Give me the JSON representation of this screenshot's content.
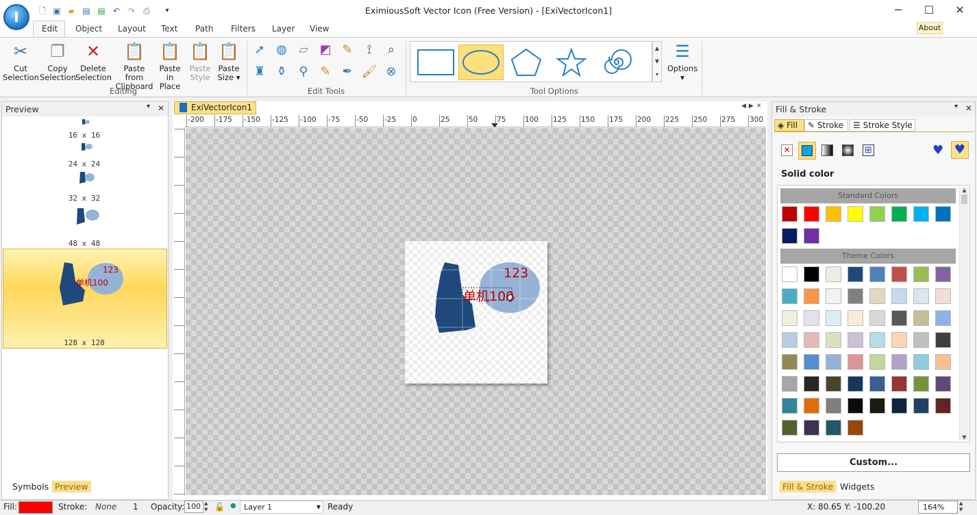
{
  "app": {
    "title": "EximiousSoft Vector Icon (Free Version) - [ExiVectorIcon1]"
  },
  "menu_tabs": [
    "Edit",
    "Object",
    "Layout",
    "Text",
    "Path",
    "Filters",
    "Layer",
    "View"
  ],
  "about_label": "About",
  "ribbon": {
    "editing": {
      "group_label": "Editing",
      "buttons": [
        {
          "line1": "Cut",
          "line2": "Selection"
        },
        {
          "line1": "Copy",
          "line2": "Selection"
        },
        {
          "line1": "Delete",
          "line2": "Selection"
        },
        {
          "line1": "Paste from",
          "line2": "Clipboard"
        },
        {
          "line1": "Paste in",
          "line2": "Place"
        },
        {
          "line1": "Paste",
          "line2": "Style"
        },
        {
          "line1": "Paste",
          "line2": "Size ▾"
        }
      ]
    },
    "edit_tools": {
      "group_label": "Edit Tools"
    },
    "tool_options": {
      "group_label": "Tool Options"
    },
    "options": {
      "label": "Options"
    }
  },
  "left_panel": {
    "title": "Preview",
    "sizes": [
      "16 x 16",
      "24 x 24",
      "32 x 32",
      "48 x 48",
      "128 x 128"
    ],
    "preview_text_number": "123",
    "preview_text_chinese": "单机100",
    "bottom_tabs": [
      "Symbols",
      "Preview"
    ]
  },
  "document": {
    "tab_label": "ExiVectorIcon1",
    "ruler_labels": [
      "-200",
      "-175",
      "-150",
      "-125",
      "-100",
      "-75",
      "-50",
      "-25",
      "0",
      "25",
      "50",
      "75",
      "100",
      "125",
      "150",
      "175",
      "200",
      "225",
      "250",
      "275",
      "300"
    ],
    "canvas_text_number": "123",
    "canvas_text_chinese": "单机100"
  },
  "right_panel": {
    "title": "Fill & Stroke",
    "tabs": [
      "Fill",
      "Stroke",
      "Stroke Style"
    ],
    "solid_color_label": "Solid color",
    "standard_colors_label": "Standard Colors",
    "theme_colors_label": "Theme Colors",
    "standard_colors": [
      "#c00000",
      "#ff0000",
      "#ffc000",
      "#ffff00",
      "#92d050",
      "#00b050",
      "#00b0f0",
      "#0070c0",
      "#002060",
      "#7030a0"
    ],
    "theme_colors": [
      "#ffffff",
      "#000000",
      "#eeece1",
      "#1f497d",
      "#4f81bd",
      "#c0504d",
      "#9bbb59",
      "#8064a2",
      "#4bacc6",
      "#f79646",
      "#f2f2f2",
      "#7f7f7f",
      "#ddd9c3",
      "#c6d9f0",
      "#dbe5f1",
      "#f2dcdb",
      "#ebf1dd",
      "#e5e0ec",
      "#dbeef3",
      "#fdeada",
      "#d8d8d8",
      "#595959",
      "#c4bd97",
      "#8db3e2",
      "#b8cce4",
      "#e5b9b7",
      "#d7e3bc",
      "#ccc1d9",
      "#b7dde8",
      "#fbd5b5",
      "#bfbfbf",
      "#3f3f3f",
      "#938953",
      "#548dd4",
      "#95b3d7",
      "#d99694",
      "#c3d69b",
      "#b2a2c7",
      "#92cddc",
      "#fac08f",
      "#a5a5a5",
      "#262626",
      "#494429",
      "#17365d",
      "#366092",
      "#953734",
      "#76923c",
      "#5f497a",
      "#31859b",
      "#e36c09",
      "#7f7f7f",
      "#0c0c0c",
      "#1d1b10",
      "#0f243e",
      "#244061",
      "#632423",
      "#4f6128",
      "#3f3151",
      "#205867",
      "#974806"
    ],
    "custom_label": "Custom...",
    "bottom_tabs": [
      "Fill & Stroke",
      "Widgets"
    ]
  },
  "status": {
    "fill_label": "Fill:",
    "fill_color": "#ff0000",
    "stroke_label": "Stroke:",
    "stroke_value": "None",
    "stroke_width": "1",
    "opacity_label": "Opacity:",
    "opacity_value": "100",
    "layer_value": "Layer 1",
    "ready": "Ready",
    "coords": "X: 80.65 Y: -100.20",
    "zoom": "164%"
  }
}
